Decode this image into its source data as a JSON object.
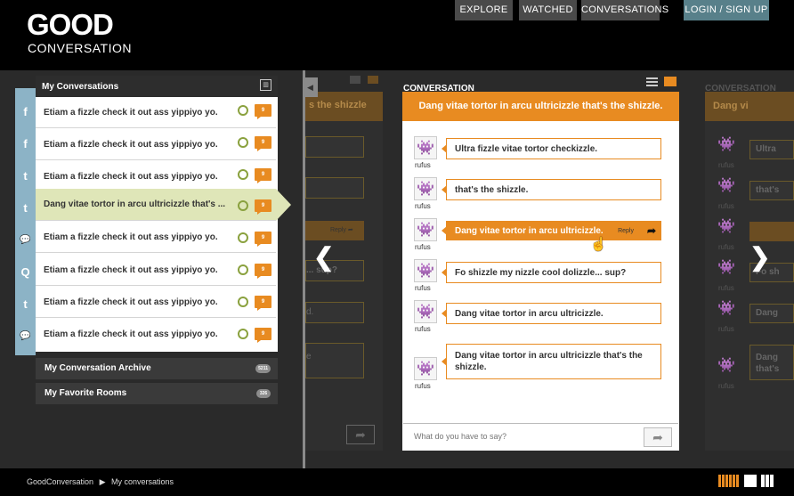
{
  "logo": {
    "top": "GOOD",
    "bottom": "CONVERSATION"
  },
  "nav": {
    "explore": "EXPLORE",
    "watched": "WATCHED",
    "conversations": "CONVERSATIONS",
    "login": "LOGIN  /  SIGN UP"
  },
  "sidebar": {
    "title": "My Conversations",
    "tabs": [
      "f",
      "f",
      "t",
      "t",
      "💬",
      "Q",
      "t",
      "💬"
    ],
    "items": [
      {
        "text": "Etiam a fizzle check it out ass yippiyo yo.",
        "badge": "9"
      },
      {
        "text": "Etiam a fizzle check it out ass yippiyo yo.",
        "badge": "9"
      },
      {
        "text": "Etiam a fizzle check it out ass yippiyo yo.",
        "badge": "9"
      },
      {
        "text": "Dang vitae tortor in arcu ultricizzle that's ...",
        "badge": "9"
      },
      {
        "text": "Etiam a fizzle check it out ass yippiyo yo.",
        "badge": "9"
      },
      {
        "text": "Etiam a fizzle check it out ass yippiyo yo.",
        "badge": "9"
      },
      {
        "text": "Etiam a fizzle check it out ass yippiyo yo.",
        "badge": "9"
      },
      {
        "text": "Etiam a fizzle check it out ass yippiyo yo.",
        "badge": "9"
      }
    ],
    "archive": {
      "label": "My Conversation Archive",
      "count": "5211"
    },
    "favorites": {
      "label": "My Favorite Rooms",
      "count": "326"
    }
  },
  "conversation": {
    "label": "CONVERSATION",
    "title": "Dang vitae tortor in arcu ultricizzle that's the shizzle.",
    "messages": [
      {
        "user": "rufus",
        "text": "Ultra fizzle vitae tortor checkizzle."
      },
      {
        "user": "rufus",
        "text": "that's the shizzle."
      },
      {
        "user": "rufus",
        "text": "Dang vitae tortor in arcu ultricizzle.",
        "reply": "Reply"
      },
      {
        "user": "rufus",
        "text": "Fo shizzle my nizzle cool dolizzle... sup?"
      },
      {
        "user": "rufus",
        "text": "Dang vitae tortor in arcu ultricizzle."
      },
      {
        "user": "rufus",
        "text": "Dang vitae tortor in arcu ultricizzle that's the shizzle."
      }
    ],
    "input_placeholder": "What do you have to say?"
  },
  "left_ghost": {
    "title": "s the shizzle",
    "reply": "Reply",
    "sup": "... sup?"
  },
  "right_ghost": {
    "label": "CONVERSATION",
    "title": "Dang vi",
    "items": [
      "Ultra",
      "that's",
      "",
      "Fo sh",
      "Dang",
      "Dang that's"
    ],
    "users": [
      "rufus",
      "rufus",
      "rufus",
      "rufus",
      "rufus",
      "rufus"
    ]
  },
  "footer": {
    "crumb1": "GoodConversation",
    "crumb2": "My conversations"
  },
  "colors": {
    "accent": "#e88b21",
    "active": "#dfe6b8",
    "tabs": "#8cb3c6"
  }
}
